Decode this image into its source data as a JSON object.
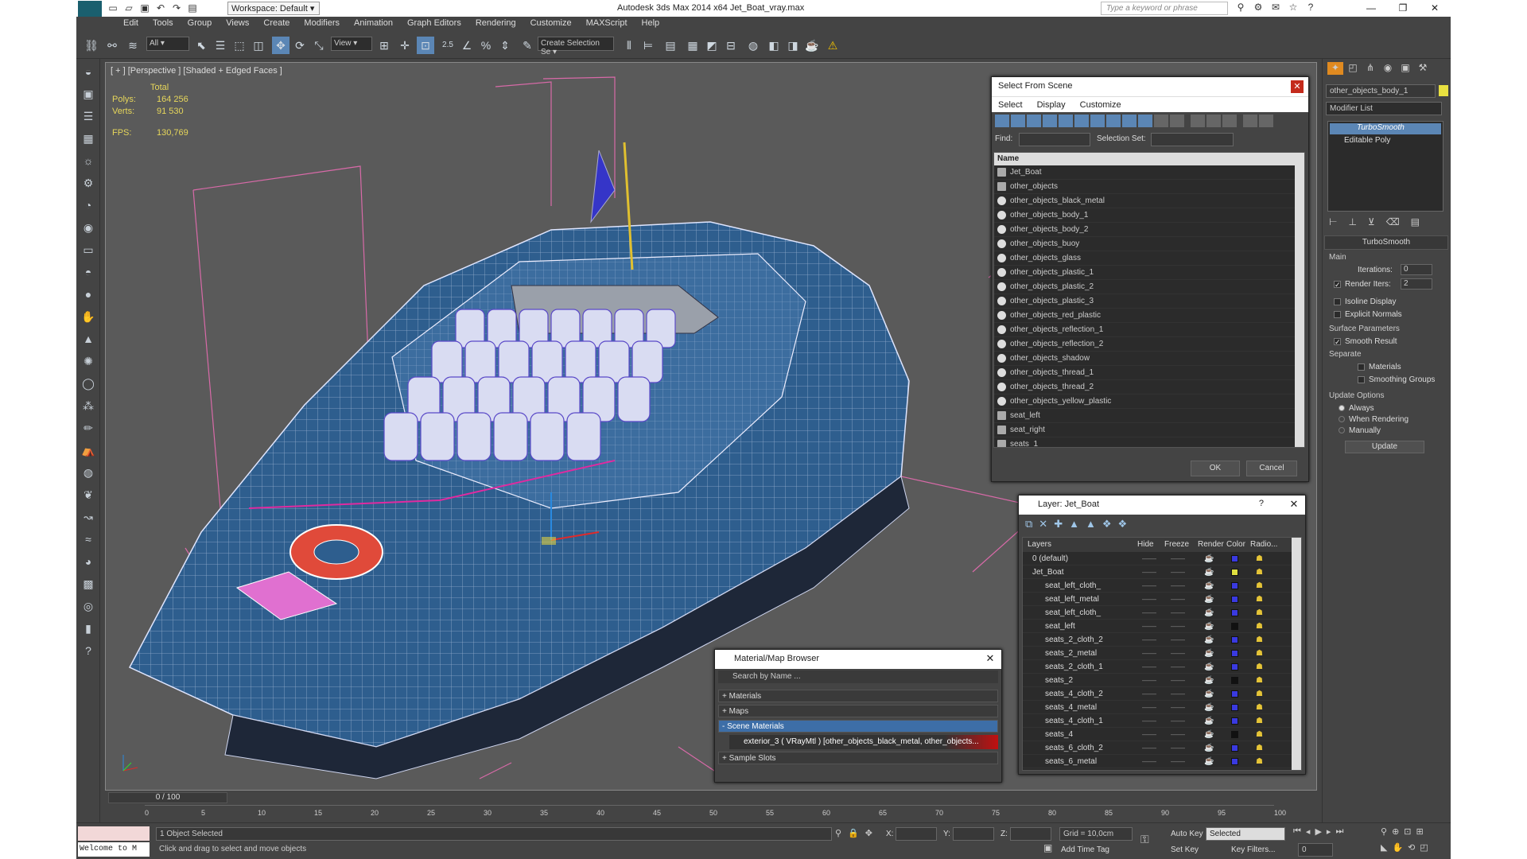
{
  "app": {
    "title": "Autodesk 3ds Max  2014 x64    Jet_Boat_vray.max",
    "workspace": "Workspace: Default",
    "search_placeholder": "Type a keyword or phrase"
  },
  "menu": [
    "Edit",
    "Tools",
    "Group",
    "Views",
    "Create",
    "Modifiers",
    "Animation",
    "Graph Editors",
    "Rendering",
    "Customize",
    "MAXScript",
    "Help"
  ],
  "toolbar": {
    "filter": "All",
    "ref_coord": "View",
    "named_sel": "Create Selection Se",
    "angle_snap": "2.5"
  },
  "viewport": {
    "label": "[ + ] [Perspective ] [Shaded + Edged Faces ]",
    "stats_header": "Total",
    "polys_label": "Polys:",
    "polys_value": "164 256",
    "verts_label": "Verts:",
    "verts_value": "91 530",
    "fps_label": "FPS:",
    "fps_value": "130,769"
  },
  "select_from_scene": {
    "title": "Select From Scene",
    "tabs": [
      "Select",
      "Display",
      "Customize"
    ],
    "find_label": "Find:",
    "selection_set_label": "Selection Set:",
    "column_name": "Name",
    "items": [
      "Jet_Boat",
      "other_objects",
      "other_objects_black_metal",
      "other_objects_body_1",
      "other_objects_body_2",
      "other_objects_buoy",
      "other_objects_glass",
      "other_objects_plastic_1",
      "other_objects_plastic_2",
      "other_objects_plastic_3",
      "other_objects_red_plastic",
      "other_objects_reflection_1",
      "other_objects_reflection_2",
      "other_objects_shadow",
      "other_objects_thread_1",
      "other_objects_thread_2",
      "other_objects_yellow_plastic",
      "seat_left",
      "seat_right",
      "seats_1"
    ],
    "ok": "OK",
    "cancel": "Cancel"
  },
  "layer_dialog": {
    "title": "Layer: Jet_Boat",
    "help": "?",
    "columns": [
      "Layers",
      "Hide",
      "Freeze",
      "Render",
      "Color",
      "Radio..."
    ],
    "rows": [
      {
        "name": "0 (default)",
        "color": "#3a3ae0"
      },
      {
        "name": "Jet_Boat",
        "color": "#e0e040"
      },
      {
        "name": "seat_left_cloth_",
        "color": "#3a3ae0"
      },
      {
        "name": "seat_left_metal",
        "color": "#3a3ae0"
      },
      {
        "name": "seat_left_cloth_",
        "color": "#3a3ae0"
      },
      {
        "name": "seat_left",
        "color": "#111111"
      },
      {
        "name": "seats_2_cloth_2",
        "color": "#3a3ae0"
      },
      {
        "name": "seats_2_metal",
        "color": "#3a3ae0"
      },
      {
        "name": "seats_2_cloth_1",
        "color": "#3a3ae0"
      },
      {
        "name": "seats_2",
        "color": "#111111"
      },
      {
        "name": "seats_4_cloth_2",
        "color": "#3a3ae0"
      },
      {
        "name": "seats_4_metal",
        "color": "#3a3ae0"
      },
      {
        "name": "seats_4_cloth_1",
        "color": "#3a3ae0"
      },
      {
        "name": "seats_4",
        "color": "#111111"
      },
      {
        "name": "seats_6_cloth_2",
        "color": "#3a3ae0"
      },
      {
        "name": "seats_6_metal",
        "color": "#3a3ae0"
      }
    ]
  },
  "material_browser": {
    "title": "Material/Map Browser",
    "search_placeholder": "Search by Name ...",
    "sections": [
      "+ Materials",
      "+ Maps"
    ],
    "scene_materials": "- Scene Materials",
    "material_entry": "exterior_3  ( VRayMtl ) [other_objects_black_metal, other_objects...",
    "sample_slots": "+ Sample Slots"
  },
  "command_panel": {
    "object_name": "other_objects_body_1",
    "modifier_list": "Modifier List",
    "stack": [
      "TurboSmooth",
      "Editable Poly"
    ],
    "rollout_title": "TurboSmooth",
    "main_label": "Main",
    "iterations_label": "Iterations:",
    "iterations_value": "0",
    "render_iters_label": "Render Iters:",
    "render_iters_value": "2",
    "isoline": "Isoline Display",
    "explicit_normals": "Explicit Normals",
    "surface_params": "Surface Parameters",
    "smooth_result": "Smooth Result",
    "separate": "Separate",
    "materials": "Materials",
    "smoothing_groups": "Smoothing Groups",
    "update_options": "Update Options",
    "always": "Always",
    "when_rendering": "When Rendering",
    "manually": "Manually",
    "update_button": "Update"
  },
  "timeline": {
    "frame": "0 / 100",
    "ticks": [
      "0",
      "5",
      "10",
      "15",
      "20",
      "25",
      "30",
      "35",
      "40",
      "45",
      "50",
      "55",
      "60",
      "65",
      "70",
      "75",
      "80",
      "85",
      "90",
      "95",
      "100"
    ]
  },
  "status": {
    "script_label": "Welcome to M",
    "selected": "1 Object Selected",
    "prompt": "Click and drag to select and move objects",
    "x_label": "X:",
    "y_label": "Y:",
    "z_label": "Z:",
    "grid": "Grid = 10,0cm",
    "add_time_tag": "Add Time Tag",
    "auto_key": "Auto Key",
    "set_key": "Set Key",
    "key_mode": "Selected",
    "key_filters": "Key Filters...",
    "frame_value": "0"
  }
}
